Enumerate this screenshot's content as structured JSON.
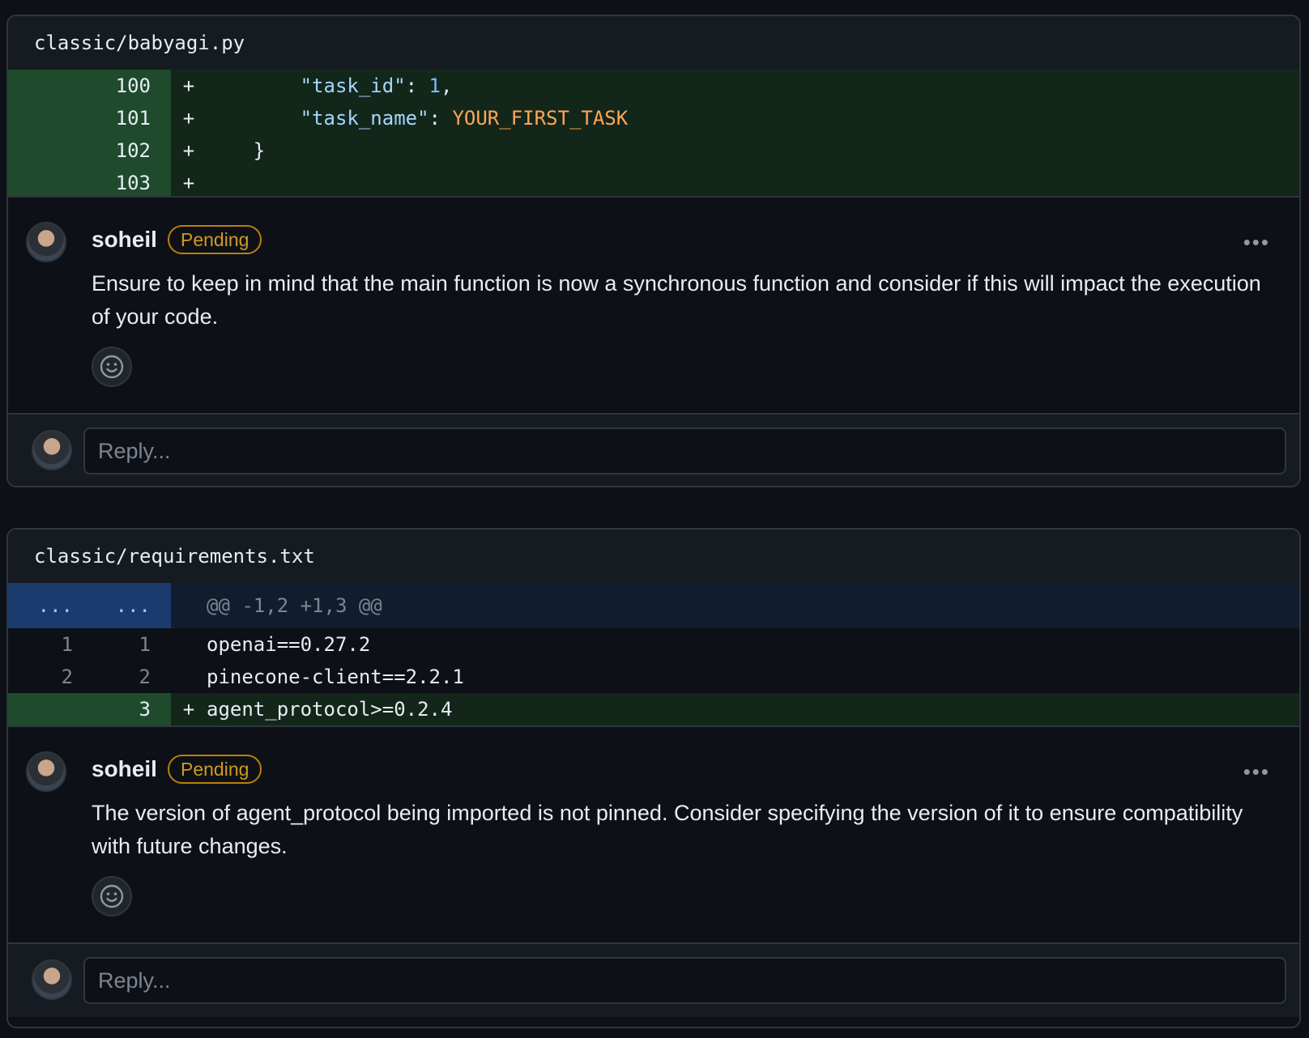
{
  "threads": [
    {
      "file": "classic/babyagi.py",
      "lines": [
        {
          "new": "100",
          "marker": "+",
          "indent": "        ",
          "key": "\"task_id\"",
          "sep": ": ",
          "value": "1",
          "tail": ","
        },
        {
          "new": "101",
          "marker": "+",
          "indent": "        ",
          "key": "\"task_name\"",
          "sep": ": ",
          "value": "YOUR_FIRST_TASK",
          "tail": ""
        },
        {
          "new": "102",
          "marker": "+",
          "text": "    }"
        },
        {
          "new": "103",
          "marker": "+",
          "text": ""
        }
      ],
      "comment": {
        "author": "soheil",
        "badge": "Pending",
        "more": "•••",
        "body": "Ensure to keep in mind that the main function is now a synchronous function and consider if this will impact the execution of your code."
      },
      "reply_placeholder": "Reply..."
    },
    {
      "file": "classic/requirements.txt",
      "hunk": {
        "old": "...",
        "new": "...",
        "text": "@@ -1,2 +1,3 @@"
      },
      "lines": [
        {
          "old": "1",
          "new": "1",
          "marker": "",
          "text": "openai==0.27.2"
        },
        {
          "old": "2",
          "new": "2",
          "marker": "",
          "text": "pinecone-client==2.2.1"
        },
        {
          "old": "",
          "new": "3",
          "marker": "+",
          "text": "agent_protocol>=0.2.4"
        }
      ],
      "comment": {
        "author": "soheil",
        "badge": "Pending",
        "more": "•••",
        "body": "The version of agent_protocol being imported is not pinned. Consider specifying the version of it to ensure compatibility with future changes."
      },
      "reply_placeholder": "Reply..."
    }
  ],
  "colors": {
    "background": "#0d1117",
    "added_gutter": "#1f4b2c",
    "added_code": "#13261a",
    "hunk": "#1b3b6f",
    "badge": "#d29922"
  }
}
